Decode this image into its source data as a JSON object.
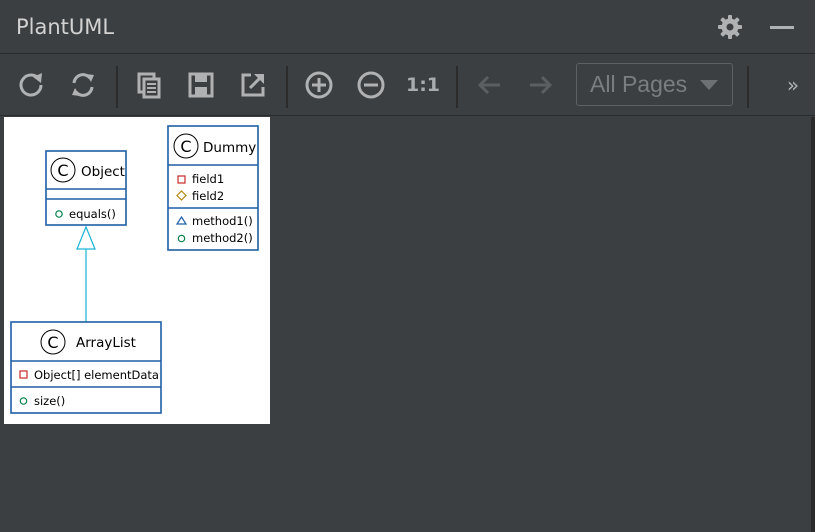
{
  "panel": {
    "title": "PlantUML"
  },
  "toolbar": {
    "buttons": [
      {
        "name": "refresh",
        "icon": "refresh-icon"
      },
      {
        "name": "reload",
        "icon": "sync-icon"
      },
      {
        "name": "copy",
        "icon": "copy-icon"
      },
      {
        "name": "save",
        "icon": "save-icon"
      },
      {
        "name": "export",
        "icon": "external-link-icon"
      },
      {
        "name": "zoom-in",
        "icon": "zoom-in-icon"
      },
      {
        "name": "zoom-out",
        "icon": "zoom-out-icon"
      },
      {
        "name": "actual-size",
        "label": "1:1"
      },
      {
        "name": "previous-page",
        "icon": "arrow-left-icon"
      },
      {
        "name": "next-page",
        "icon": "arrow-right-icon"
      }
    ],
    "page_select": {
      "selected": "All Pages"
    },
    "overflow_label": "»"
  },
  "diagram": {
    "classes": [
      {
        "name": "Object",
        "stereotype_letter": "C",
        "fields": [],
        "methods": [
          {
            "visibility": "public",
            "text": "equals()"
          }
        ]
      },
      {
        "name": "Dummy",
        "stereotype_letter": "C",
        "fields": [
          {
            "visibility": "private",
            "text": "field1"
          },
          {
            "visibility": "protected",
            "text": "field2"
          }
        ],
        "methods": [
          {
            "visibility": "package",
            "text": "method1()"
          },
          {
            "visibility": "public",
            "text": "method2()"
          }
        ]
      },
      {
        "name": "ArrayList",
        "stereotype_letter": "C",
        "fields": [
          {
            "visibility": "private",
            "text": "Object[] elementData"
          }
        ],
        "methods": [
          {
            "visibility": "public",
            "text": "size()"
          }
        ]
      }
    ],
    "relations": [
      {
        "type": "inheritance",
        "from": "ArrayList",
        "to": "Object"
      }
    ],
    "colors": {
      "border": "#1f5fa6",
      "arrow": "#19b3d6",
      "private": "#c82828",
      "protected": "#b8860b",
      "package": "#1f5fa6",
      "public": "#038048"
    }
  }
}
